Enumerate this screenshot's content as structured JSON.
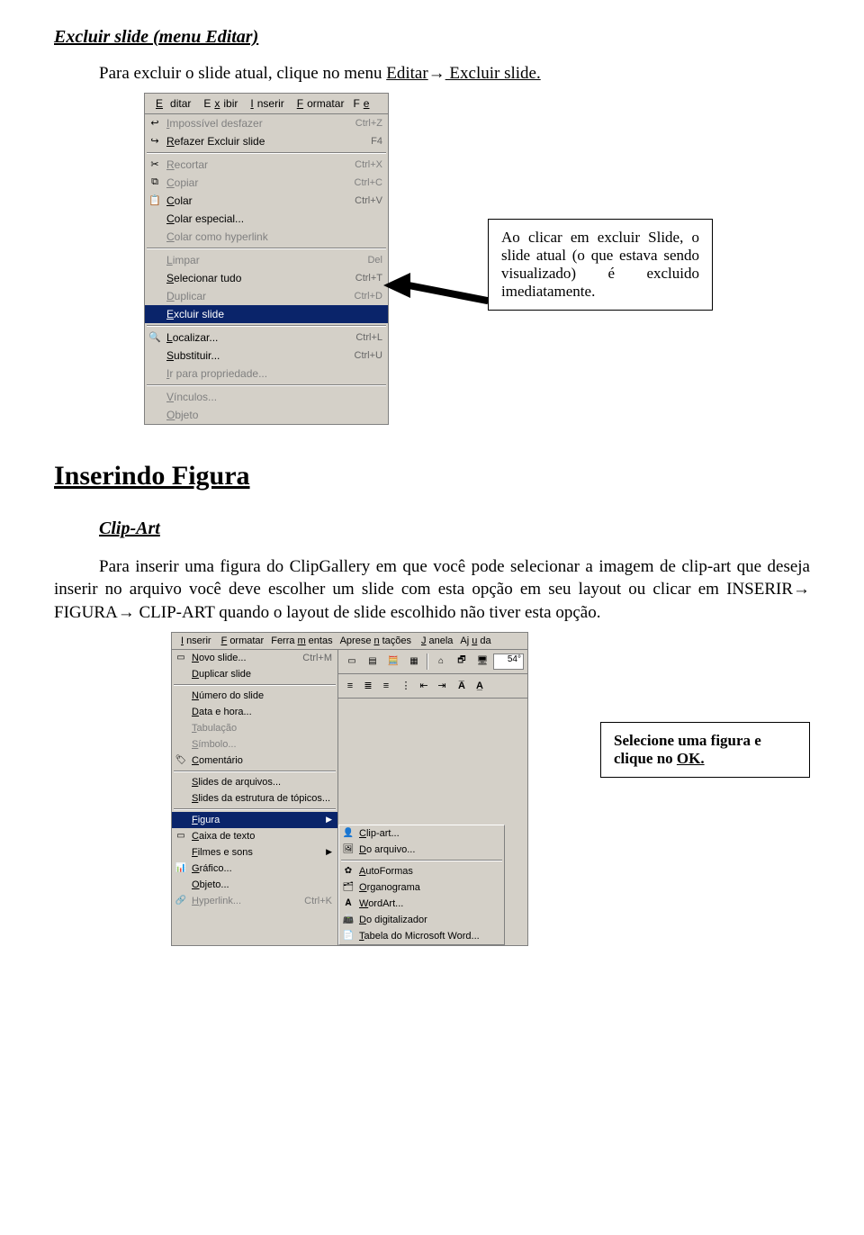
{
  "headings": {
    "h1": "Excluir slide (menu Editar)",
    "h2": "Inserindo Figura",
    "h3": "Clip-Art"
  },
  "paragraphs": {
    "p1a": "Para excluir o slide atual, clique no menu ",
    "p1b": "Editar",
    "p1c": " Excluir slide.",
    "callout1": "Ao clicar em excluir Slide, o slide atual (o que estava sendo visualizado) é excluido imediatamente.",
    "p2": "Para inserir uma figura do ClipGallery em que você pode selecionar a imagem de clip-art que deseja inserir no arquivo você deve escolher um slide com esta opção em seu layout ou clicar em INSERIR→ FIGURA→ CLIP-ART quando o layout de slide escolhido não tiver esta opção.",
    "callout2a": "Selecione uma figura e clique no ",
    "callout2b": "OK."
  },
  "menu1": {
    "bar": [
      "Editar",
      "Exibir",
      "Inserir",
      "Formatar",
      "Fe"
    ],
    "items": [
      {
        "icon": "↩",
        "label": "Impossível desfazer",
        "sc": "Ctrl+Z",
        "disabled": true
      },
      {
        "icon": "↪",
        "label": "Refazer Excluir slide",
        "sc": "F4"
      },
      {
        "sep": true
      },
      {
        "icon": "✂",
        "label": "Recortar",
        "sc": "Ctrl+X",
        "disabled": true
      },
      {
        "icon": "⧉",
        "label": "Copiar",
        "sc": "Ctrl+C",
        "disabled": true
      },
      {
        "icon": "📋",
        "label": "Colar",
        "sc": "Ctrl+V"
      },
      {
        "icon": "",
        "label": "Colar especial...",
        "sc": ""
      },
      {
        "icon": "",
        "label": "Colar como hyperlink",
        "sc": "",
        "disabled": true
      },
      {
        "sep": true
      },
      {
        "icon": "",
        "label": "Limpar",
        "sc": "Del",
        "disabled": true
      },
      {
        "icon": "",
        "label": "Selecionar tudo",
        "sc": "Ctrl+T"
      },
      {
        "icon": "",
        "label": "Duplicar",
        "sc": "Ctrl+D",
        "disabled": true
      },
      {
        "icon": "",
        "label": "Excluir slide",
        "sc": "",
        "highlight": true
      },
      {
        "sep": true
      },
      {
        "icon": "🔍",
        "label": "Localizar...",
        "sc": "Ctrl+L"
      },
      {
        "icon": "",
        "label": "Substituir...",
        "sc": "Ctrl+U"
      },
      {
        "icon": "",
        "label": "Ir para propriedade...",
        "sc": "",
        "disabled": true
      },
      {
        "sep": true
      },
      {
        "icon": "",
        "label": "Vínculos...",
        "sc": "",
        "disabled": true
      },
      {
        "icon": "",
        "label": "Objeto",
        "sc": "",
        "disabled": true
      }
    ]
  },
  "menu2": {
    "bar": [
      "Inserir",
      "Formatar",
      "Ferramentas",
      "Apresentações",
      "Janela",
      "Ajuda"
    ],
    "toolbar_icons": [
      "▭",
      "▤",
      "🧮",
      "▦",
      "⌂",
      "🗗",
      "🖥",
      "54°"
    ],
    "toolbar2": [
      "≣",
      "≣",
      "≣",
      "≣",
      "⋮",
      "⇆",
      "⇵",
      "A͈",
      "A̅"
    ],
    "zoom": "54°",
    "left_items": [
      {
        "icon": "▭",
        "label": "Novo slide...",
        "sc": "Ctrl+M"
      },
      {
        "icon": "",
        "label": "Duplicar slide",
        "sc": ""
      },
      {
        "sep": true
      },
      {
        "icon": "",
        "label": "Número do slide",
        "sc": ""
      },
      {
        "icon": "",
        "label": "Data e hora...",
        "sc": ""
      },
      {
        "icon": "",
        "label": "Tabulação",
        "sc": "",
        "disabled": true
      },
      {
        "icon": "",
        "label": "Símbolo...",
        "sc": "",
        "disabled": true
      },
      {
        "icon": "🏷",
        "label": "Comentário",
        "sc": ""
      },
      {
        "sep": true
      },
      {
        "icon": "",
        "label": "Slides de arquivos...",
        "sc": ""
      },
      {
        "icon": "",
        "label": "Slides da estrutura de tópicos...",
        "sc": ""
      },
      {
        "sep": true
      },
      {
        "icon": "",
        "label": "Figura",
        "sc": "",
        "highlight": true,
        "arrow": true
      },
      {
        "icon": "▭",
        "label": "Caixa de texto",
        "sc": ""
      },
      {
        "icon": "",
        "label": "Filmes e sons",
        "sc": "",
        "arrow": true
      },
      {
        "icon": "📊",
        "label": "Gráfico...",
        "sc": ""
      },
      {
        "icon": "",
        "label": "Objeto...",
        "sc": ""
      },
      {
        "icon": "🔗",
        "label": "Hyperlink...",
        "sc": "Ctrl+K",
        "disabled": true
      }
    ],
    "submenu": [
      {
        "icon": "👤",
        "label": "Clip-art..."
      },
      {
        "icon": "🖼",
        "label": "Do arquivo..."
      },
      {
        "sep": true
      },
      {
        "icon": "✿",
        "label": "AutoFormas"
      },
      {
        "icon": "🗂",
        "label": "Organograma"
      },
      {
        "icon": "𝐀",
        "label": "WordArt..."
      },
      {
        "icon": "📠",
        "label": "Do digitalizador"
      },
      {
        "icon": "📄",
        "label": "Tabela do Microsoft Word..."
      }
    ]
  }
}
